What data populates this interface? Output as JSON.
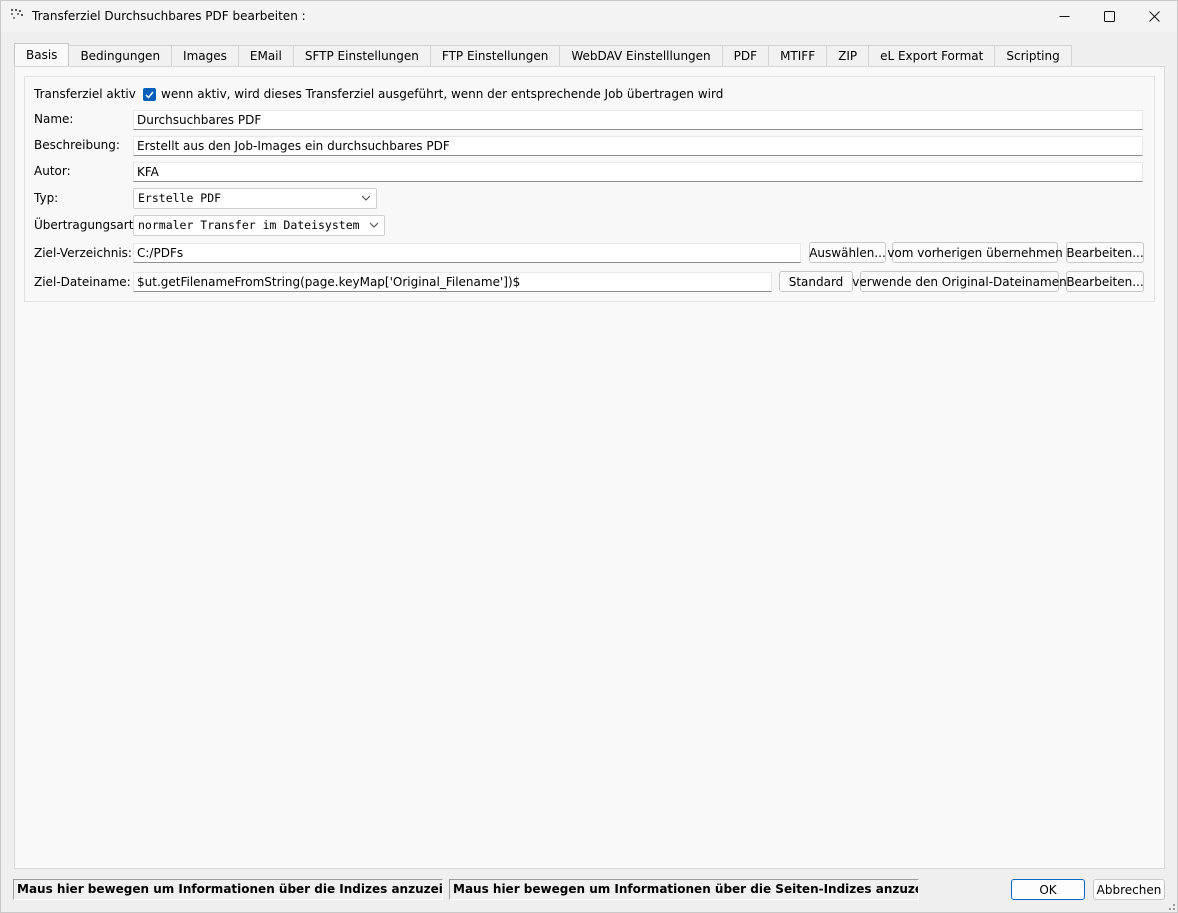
{
  "window": {
    "title": "Transferziel Durchsuchbares PDF bearbeiten :",
    "minimize_icon": "minimize-icon",
    "maximize_icon": "maximize-icon",
    "close_icon": "close-icon"
  },
  "tabs": [
    {
      "label": "Basis",
      "active": true
    },
    {
      "label": "Bedingungen"
    },
    {
      "label": "Images"
    },
    {
      "label": "EMail"
    },
    {
      "label": "SFTP Einstellungen"
    },
    {
      "label": "FTP Einstellungen"
    },
    {
      "label": "WebDAV Einstelllungen"
    },
    {
      "label": "PDF"
    },
    {
      "label": "MTIFF"
    },
    {
      "label": "ZIP"
    },
    {
      "label": "eL Export Format"
    },
    {
      "label": "Scripting"
    }
  ],
  "form": {
    "active": {
      "label": "Transferziel aktiv",
      "checked": true,
      "checkbox_text": "wenn aktiv, wird dieses Transferziel ausgeführt, wenn der entsprechende Job übertragen wird"
    },
    "name": {
      "label": "Name:",
      "value": "Durchsuchbares PDF"
    },
    "description": {
      "label": "Beschreibung:",
      "value": "Erstellt aus den Job-Images ein durchsuchbares PDF"
    },
    "author": {
      "label": "Autor:",
      "value": "KFA"
    },
    "type": {
      "label": "Typ:",
      "value": "Erstelle PDF"
    },
    "transfer_mode": {
      "label": "Übertragungsart:",
      "value": "normaler Transfer im Dateisystem"
    },
    "target_dir": {
      "label": "Ziel-Verzeichnis:",
      "value": "C:/PDFs",
      "buttons": {
        "select": "Auswählen...",
        "previous": "vom vorherigen übernehmen",
        "edit": "Bearbeiten..."
      }
    },
    "target_filename": {
      "label": "Ziel-Dateiname:",
      "value": "$ut.getFilenameFromString(page.keyMap['Original_Filename'])$",
      "buttons": {
        "standard": "Standard",
        "original": "verwende den Original-Dateinamen",
        "edit": "Bearbeiten..."
      }
    }
  },
  "status": {
    "indices": "Maus hier bewegen um Informationen über die Indizes anzuzeigen...",
    "page_indices": "Maus hier bewegen um Informationen über die Seiten-Indizes anzuzeigen..."
  },
  "footer": {
    "ok": "OK",
    "cancel": "Abbrechen"
  },
  "colors": {
    "accent": "#005fb8",
    "ok_border": "#0067c0"
  }
}
